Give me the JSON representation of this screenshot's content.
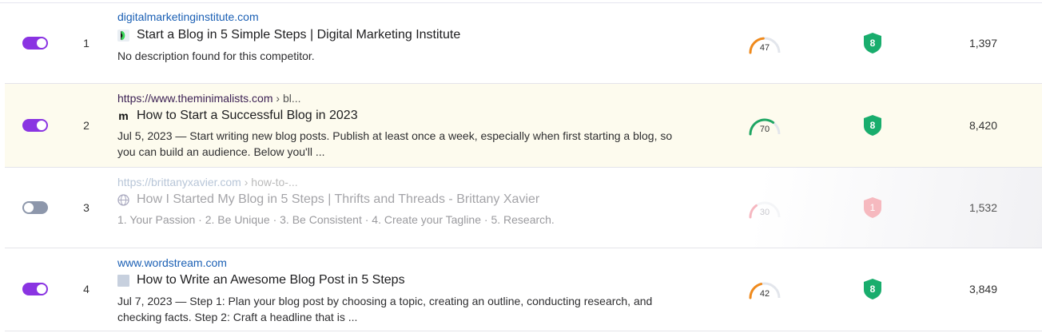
{
  "rows": [
    {
      "rank": "1",
      "enabled": true,
      "domain": "digitalmarketinginstitute.com",
      "breadcrumb": "",
      "title": "Start a Blog in 5 Simple Steps | Digital Marketing Institute",
      "description": "No description found for this competitor.",
      "score": "47",
      "score_fraction": 0.47,
      "authority": "8",
      "traffic": "1,397",
      "favicon": "dmi-logo-icon"
    },
    {
      "rank": "2",
      "enabled": true,
      "domain": "https://www.theminimalists.com",
      "breadcrumb": " › bl...",
      "title": "How to Start a Successful Blog in 2023",
      "description": "Jul 5, 2023 — Start writing new blog posts. Publish at least once a week, especially when first starting a blog, so you can build an audience. Below you'll ...",
      "score": "70",
      "score_fraction": 0.7,
      "authority": "8",
      "traffic": "8,420",
      "favicon": "minimalists-m-icon",
      "favicon_text": "m"
    },
    {
      "rank": "3",
      "enabled": false,
      "domain": "https://brittanyxavier.com",
      "breadcrumb": " › how-to-...",
      "title": "How I Started My Blog in 5 Steps | Thrifts and Threads - Brittany Xavier",
      "description": "1. Your Passion · 2. Be Unique · 3. Be Consistent · 4. Create your Tagline · 5. Research.",
      "score": "30",
      "score_fraction": 0.3,
      "authority": "1",
      "traffic": "1,532",
      "favicon": "globe-icon"
    },
    {
      "rank": "4",
      "enabled": true,
      "domain": "www.wordstream.com",
      "breadcrumb": "",
      "title": "How to Write an Awesome Blog Post in 5 Steps",
      "description": "Jul 7, 2023 — Step 1: Plan your blog post by choosing a topic, creating an outline, conducting research, and checking facts. Step 2: Craft a headline that is ...",
      "score": "42",
      "score_fraction": 0.42,
      "authority": "8",
      "traffic": "3,849",
      "favicon": "placeholder-square-icon"
    }
  ],
  "colors": {
    "toggle_on": "#8a34e2",
    "toggle_off": "#8d97ab",
    "link": "#1a5fb4",
    "score_orange": "#f08a1c",
    "score_green": "#1ea662",
    "score_red": "#e8344e",
    "shield_green": "#19ad6d",
    "row_highlight": "#fdfbee"
  }
}
